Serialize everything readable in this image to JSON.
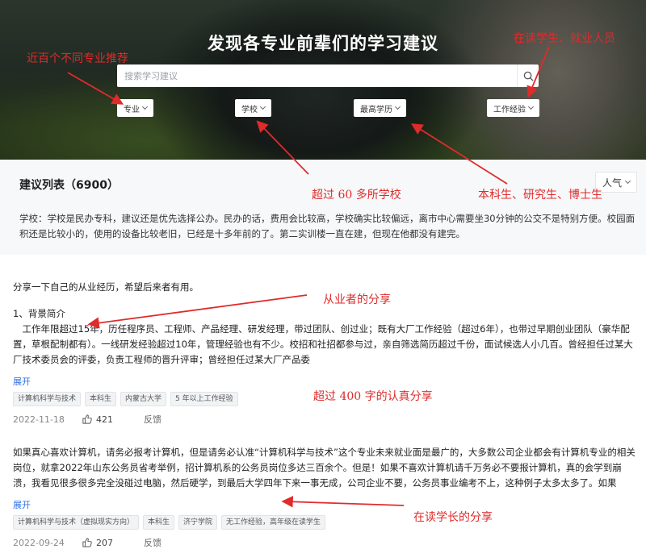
{
  "hero": {
    "title": "发现各专业前辈们的学习建议",
    "search_placeholder": "搜索学习建议"
  },
  "filters": [
    "专业",
    "学校",
    "最高学历",
    "工作经验"
  ],
  "list": {
    "title": "建议列表（6900）",
    "sort_label": "人气",
    "intro": "学校：学校是民办专科，建议还是优先选择公办。民办的话，费用会比较高，学校确实比较偏远，离市中心需要坐30分钟的公交不是特别方便。校园面积还是比较小的，使用的设备比较老旧，已经是十多年前的了。第二实训楼一直在建，但现在他都没有建完。"
  },
  "posts": [
    {
      "lines": [
        "分享一下自己的从业经历，希望后来者有用。",
        "1、背景简介",
        "　工作年限超过15年，历任程序员、工程师、产品经理、研发经理，带过团队、创过业；既有大厂工作经验（超过6年），也带过早期创业团队（豪华配置，草根配制都有）。一线研发经验超过10年，管理经验也有不少。校招和社招都参与过，亲自筛选简历超过千份，面试候选人小几百。曾经担任过某大厂技术委员会的评委，负责工程师的晋升评审；曾经担任过某大厂产品委"
      ],
      "expand_label": "展开",
      "tags": [
        "计算机科学与技术",
        "本科生",
        "内蒙古大学",
        "5 年以上工作经验"
      ],
      "date": "2022-11-18",
      "likes": "421",
      "report_label": "反馈"
    },
    {
      "lines": [
        "如果真心喜欢计算机，请务必报考计算机，但是请务必认准“计算机科学与技术”这个专业未来就业面是最广的，大多数公司企业都会有计算机专业的相关岗位，就拿2022年山东公务员省考举例，招计算机系的公务员岗位多达三百余个。但是！如果不喜欢计算机请千万务必不要报计算机，真的会学到崩溃，我看见很多很多完全没碰过电脑，然后硬学，到最后大学四年下来一事无成，公司企业不要，公务员事业编考不上，这种例子太多太多了。如果"
      ],
      "expand_label": "展开",
      "tags": [
        "计算机科学与技术（虚拟现实方向）",
        "本科生",
        "济宁学院",
        "无工作经验，高年级在读学生"
      ],
      "date": "2022-09-24",
      "likes": "207",
      "report_label": "反馈"
    }
  ],
  "annotations": {
    "majors": "近百个不同专业推荐",
    "companies": "在读学生、就业人员",
    "schools": "超过 60 多所学校",
    "degrees": "本科生、研究生、博士生",
    "practitioner": "从业者的分享",
    "length": "超过 400 字的认真分享",
    "student": "在读学长的分享"
  },
  "colors": {
    "annotation": "#e02b2b",
    "link": "#2f6fe5"
  }
}
